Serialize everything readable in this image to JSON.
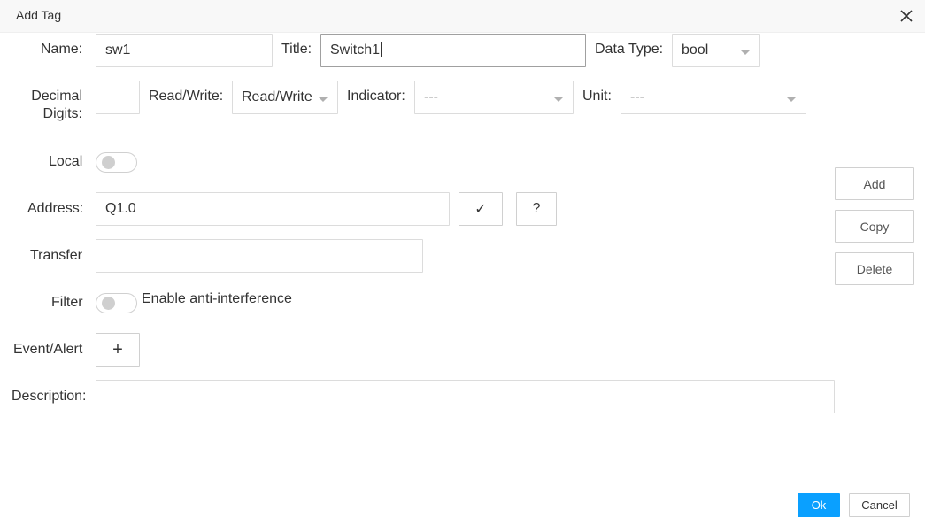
{
  "dialog": {
    "title": "Add Tag"
  },
  "form": {
    "name": {
      "label": "Name:",
      "value": "sw1"
    },
    "title": {
      "label": "Title:",
      "value": "Switch1"
    },
    "data_type": {
      "label": "Data Type:",
      "value": "bool"
    },
    "decimal_digits": {
      "label_line1": "Decimal",
      "label_line2": "Digits:",
      "value": ""
    },
    "read_write": {
      "label": "Read/Write:",
      "value": "Read/Write"
    },
    "indicator": {
      "label": "Indicator:",
      "value": "---"
    },
    "unit": {
      "label": "Unit:",
      "value": "---"
    },
    "local": {
      "label": "Local",
      "enabled": false
    },
    "address": {
      "label": "Address:",
      "value": "Q1.0",
      "verify_glyph": "✓",
      "help_glyph": "?"
    },
    "transfer": {
      "label": "Transfer",
      "value": ""
    },
    "filter": {
      "label": "Filter",
      "enabled": false,
      "caption": "Enable anti-interference"
    },
    "event_alert": {
      "label": "Event/Alert",
      "add_glyph": "+"
    },
    "description": {
      "label": "Description:",
      "value": ""
    }
  },
  "side_buttons": {
    "add": "Add",
    "copy": "Copy",
    "delete": "Delete"
  },
  "footer": {
    "ok": "Ok",
    "cancel": "Cancel"
  },
  "colors": {
    "primary": "#0aa0ff",
    "border": "#dcdcdc",
    "toggle_off": "#cfcfcf"
  }
}
